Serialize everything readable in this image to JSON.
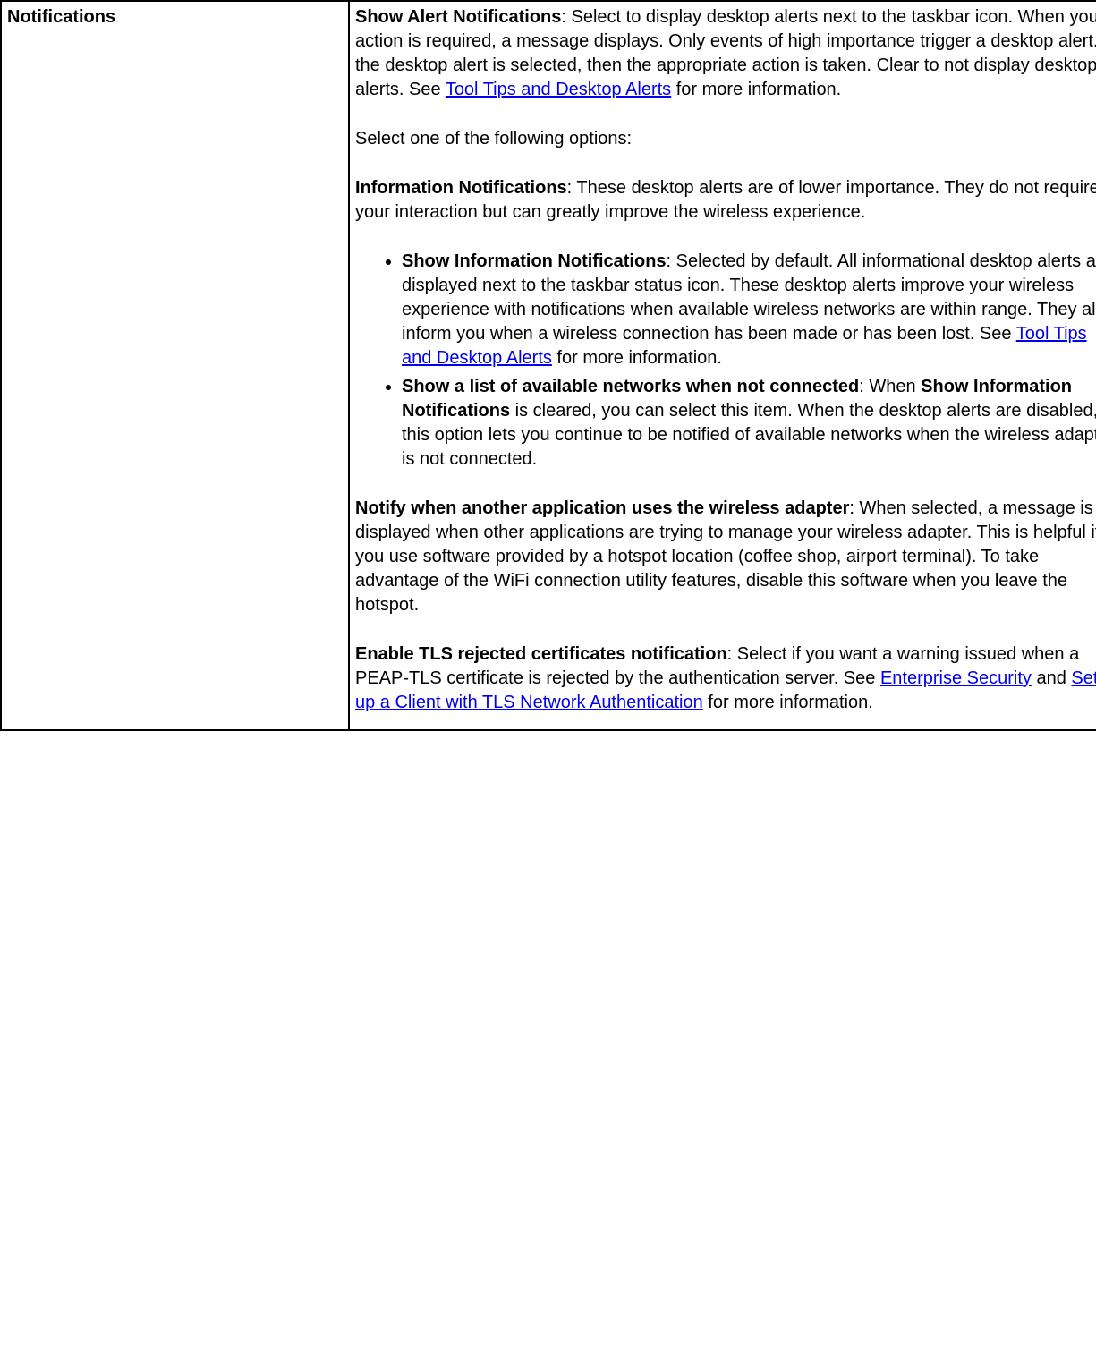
{
  "left": {
    "heading": "Notifications"
  },
  "right": {
    "p1": {
      "lead": "Show Alert Notifications",
      "text": ": Select to display desktop alerts next to the taskbar icon. When your action is required, a message displays. Only events of high importance trigger a desktop alert. If the desktop alert is selected, then the appropriate action is taken. Clear to not display desktop alerts. See ",
      "link": "Tool Tips and Desktop Alerts",
      "after_link": " for more information."
    },
    "p2": "Select one of the following options:",
    "p3": {
      "lead": "Information Notifications",
      "text": ": These desktop alerts are of lower importance. They do not require your interaction but can greatly improve the wireless experience."
    },
    "bullets": [
      {
        "lead": "Show Information Notifications",
        "text": ": Selected by default. All informational desktop alerts are displayed next to the taskbar status icon. These desktop alerts improve your wireless experience with notifications when available wireless networks are within range. They also inform you when a wireless connection has been made or has been lost. See ",
        "link": "Tool Tips and Desktop Alerts",
        "after_link": " for more information."
      },
      {
        "lead": "Show a list of available networks when not connected",
        "text1": ": When ",
        "bold2": "Show Information Notifications",
        "text2": " is cleared, you can select this item. When the desktop alerts are disabled, this option lets you continue to be notified of available networks when the wireless adapter is not connected."
      }
    ],
    "p4": {
      "lead": "Notify when another application uses the wireless adapter",
      "text": ": When selected, a message is displayed when other applications are trying to manage your wireless adapter. This is helpful if you use software provided by a hotspot location (coffee shop, airport terminal). To take advantage of the WiFi connection utility features, disable this software when you leave the hotspot."
    },
    "p5": {
      "lead": "Enable TLS rejected certificates notification",
      "text1": ": Select if you want a warning issued when a PEAP-TLS certificate is rejected by the authentication server. See ",
      "link1": "Enterprise Security",
      "mid": " and ",
      "link2": "Set up a Client with TLS Network Authentication",
      "after": " for more information."
    }
  }
}
